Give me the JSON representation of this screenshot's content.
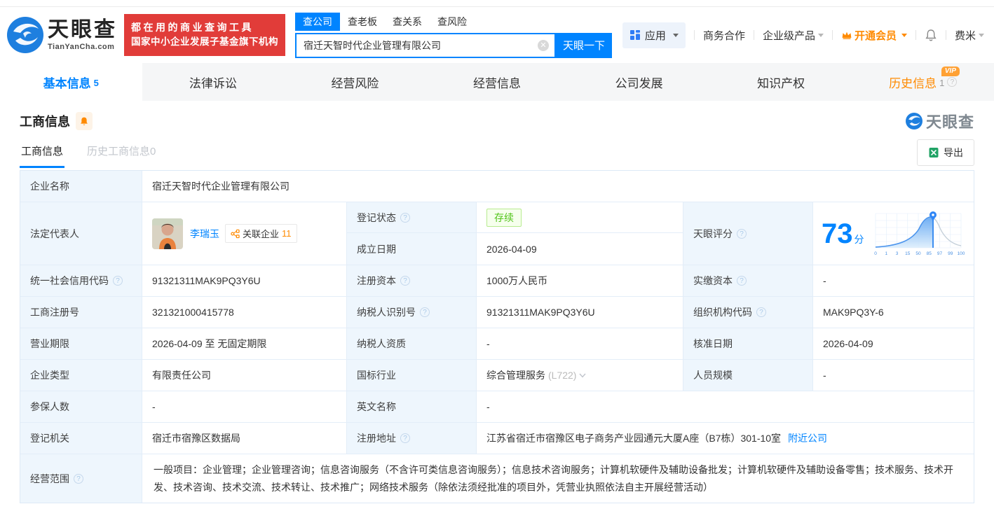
{
  "colors": {
    "accent_blue": "#0084ff",
    "promo_red": "#e13c39",
    "vip_orange": "#ff8a00",
    "status_green": "#52c41a"
  },
  "brand": {
    "name": "天眼查",
    "domain": "TianYanCha.com",
    "slogan_line1": "都在用的商业查询工具",
    "slogan_line2": "国家中小企业发展子基金旗下机构",
    "watermark": "天眼查"
  },
  "search": {
    "tabs": [
      {
        "label": "查公司"
      },
      {
        "label": "查老板"
      },
      {
        "label": "查关系"
      },
      {
        "label": "查风险"
      }
    ],
    "input_value": "宿迁天智时代企业管理有限公司",
    "button_label": "天眼一下"
  },
  "topnav": {
    "apps": "应用",
    "cooperation": "商务合作",
    "enterprise_product": "企业级产品",
    "vip": "开通会员",
    "username": "费米"
  },
  "tabs": [
    {
      "label": "基本信息",
      "count": "5"
    },
    {
      "label": "法律诉讼"
    },
    {
      "label": "经营风险"
    },
    {
      "label": "经营信息"
    },
    {
      "label": "公司发展"
    },
    {
      "label": "知识产权"
    },
    {
      "label": "历史信息",
      "count": "1",
      "vip_badge": "VIP"
    }
  ],
  "section": {
    "title": "工商信息",
    "subtab_active": "工商信息",
    "subtab_inactive": "历史工商信息0",
    "export_label": "导出"
  },
  "table": {
    "company_name": {
      "label": "企业名称",
      "value": "宿迁天智时代企业管理有限公司"
    },
    "legal_rep": {
      "label": "法定代表人",
      "name": "李瑞玉",
      "related_label": "关联企业",
      "related_count": "11"
    },
    "reg_status": {
      "label": "登记状态",
      "value": "存续"
    },
    "establish_date": {
      "label": "成立日期",
      "value": "2026-04-09"
    },
    "score": {
      "label": "天眼评分",
      "value": "73",
      "unit": "分",
      "axis": [
        "0",
        "1",
        "3",
        "15",
        "50",
        "85",
        "97",
        "99",
        "100"
      ]
    },
    "credit_code": {
      "label": "统一社会信用代码",
      "value": "91321311MAK9PQ3Y6U"
    },
    "reg_capital": {
      "label": "注册资本",
      "value": "1000万人民币"
    },
    "paid_capital": {
      "label": "实缴资本",
      "value": "-"
    },
    "reg_number": {
      "label": "工商注册号",
      "value": "321321000415778"
    },
    "taxpayer_id": {
      "label": "纳税人识别号",
      "value": "91321311MAK9PQ3Y6U"
    },
    "org_code": {
      "label": "组织机构代码",
      "value": "MAK9PQ3Y-6"
    },
    "business_term": {
      "label": "营业期限",
      "value": "2026-04-09 至 无固定期限"
    },
    "taxpayer_quality": {
      "label": "纳税人资质",
      "value": "-"
    },
    "approval_date": {
      "label": "核准日期",
      "value": "2026-04-09"
    },
    "company_type": {
      "label": "企业类型",
      "value": "有限责任公司"
    },
    "industry": {
      "label": "国标行业",
      "value": "综合管理服务",
      "code": "(L722)"
    },
    "staff_size": {
      "label": "人员规模",
      "value": "-"
    },
    "insured_count": {
      "label": "参保人数",
      "value": "-"
    },
    "english_name": {
      "label": "英文名称",
      "value": "-"
    },
    "reg_authority": {
      "label": "登记机关",
      "value": "宿迁市宿豫区数据局"
    },
    "reg_address": {
      "label": "注册地址",
      "value": "江苏省宿迁市宿豫区电子商务产业园通元大厦A座（B7栋）301-10室",
      "nearby_link": "附近公司"
    },
    "business_scope": {
      "label": "经营范围",
      "value": "一般项目：企业管理；企业管理咨询；信息咨询服务（不含许可类信息咨询服务）；信息技术咨询服务；计算机软硬件及辅助设备批发；计算机软硬件及辅助设备零售；技术服务、技术开发、技术咨询、技术交流、技术转让、技术推广；网络技术服务（除依法须经批准的项目外，凭营业执照依法自主开展经营活动）"
    }
  }
}
